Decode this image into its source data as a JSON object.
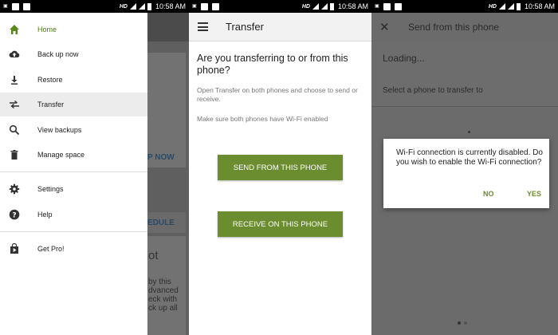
{
  "status_bar": {
    "hd": "HD",
    "time": "10:58 AM"
  },
  "panel1": {
    "drawer": {
      "items": [
        {
          "label": "Home",
          "icon": "home-icon"
        },
        {
          "label": "Back up now",
          "icon": "cloud-upload-icon"
        },
        {
          "label": "Restore",
          "icon": "download-icon"
        },
        {
          "label": "Transfer",
          "icon": "transfer-icon"
        },
        {
          "label": "View backups",
          "icon": "search-icon"
        },
        {
          "label": "Manage space",
          "icon": "trash-icon"
        },
        {
          "label": "Settings",
          "icon": "gear-icon"
        },
        {
          "label": "Help",
          "icon": "help-icon"
        },
        {
          "label": "Get Pro!",
          "icon": "play-store-icon"
        }
      ]
    },
    "background": {
      "p_now": "P NOW",
      "edule": "EDULE",
      "ot": "ot",
      "text_lines": [
        "by this",
        "dvanced",
        "eck with",
        "ck up all"
      ]
    }
  },
  "panel2": {
    "title": "Transfer",
    "question": "Are you transferring to or from this phone?",
    "instruction": "Open Transfer on both phones and choose to send or receive.",
    "wifi_note": "Make sure both phones have Wi-Fi enabled",
    "send_button": "SEND FROM THIS PHONE",
    "receive_button": "RECEIVE ON THIS PHONE"
  },
  "panel3": {
    "title": "Send from this phone",
    "loading": "Loading...",
    "select_prompt": "Select a phone to transfer to",
    "dialog": {
      "message": "Wi-Fi connection is currently disabled. Do you wish to enable the Wi-Fi connection?",
      "no": "NO",
      "yes": "YES"
    }
  },
  "colors": {
    "accent_green": "#6b8c2f",
    "active_label": "#4c7a15"
  }
}
